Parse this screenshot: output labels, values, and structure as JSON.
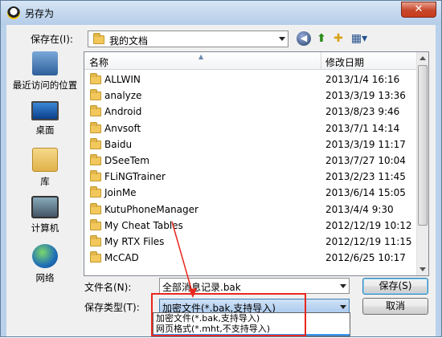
{
  "window": {
    "title": "另存为",
    "close_label": "✕"
  },
  "toolbar": {
    "save_in_label": "保存在(I):",
    "save_in_value": "我的文档",
    "back_icon": "back-arrow-icon",
    "up_icon": "up-folder-icon",
    "new_folder_icon": "new-folder-icon",
    "view_icon": "view-menu-icon"
  },
  "places": [
    {
      "label": "最近访问的位置",
      "icon": "recent-places-icon"
    },
    {
      "label": "桌面",
      "icon": "desktop-icon"
    },
    {
      "label": "库",
      "icon": "library-icon"
    },
    {
      "label": "计算机",
      "icon": "computer-icon"
    },
    {
      "label": "网络",
      "icon": "network-icon"
    }
  ],
  "file_list": {
    "columns": [
      "名称",
      "修改日期"
    ],
    "rows": [
      {
        "name": "ALLWIN",
        "date": "2013/1/4 16:16"
      },
      {
        "name": "analyze",
        "date": "2013/3/19 13:36"
      },
      {
        "name": "Android",
        "date": "2013/8/23 9:46"
      },
      {
        "name": "Anvsoft",
        "date": "2013/7/1 14:14"
      },
      {
        "name": "Baidu",
        "date": "2013/3/19 11:17"
      },
      {
        "name": "DSeeTem",
        "date": "2013/7/27 10:04"
      },
      {
        "name": "FLiNGTrainer",
        "date": "2013/2/23 11:45"
      },
      {
        "name": "JoinMe",
        "date": "2013/6/14 15:05"
      },
      {
        "name": "KutuPhoneManager",
        "date": "2013/4/4 9:30"
      },
      {
        "name": "My Cheat Tables",
        "date": "2012/12/19 10:12"
      },
      {
        "name": "My RTX Files",
        "date": "2012/12/19 11:15"
      },
      {
        "name": "McCAD",
        "date": "2012/6/25 10:17"
      }
    ]
  },
  "form": {
    "filename_label": "文件名(N):",
    "filename_value": "全部消息记录.bak",
    "filetype_label": "保存类型(T):",
    "filetype_value": "加密文件(*.bak,支持导入)",
    "filetype_options": [
      "加密文件(*.bak,支持导入)",
      "网页格式(*.mht,不支持导入)"
    ],
    "save_label": "保存(S)",
    "cancel_label": "取消"
  },
  "annotation": {
    "color": "#e8281e"
  }
}
